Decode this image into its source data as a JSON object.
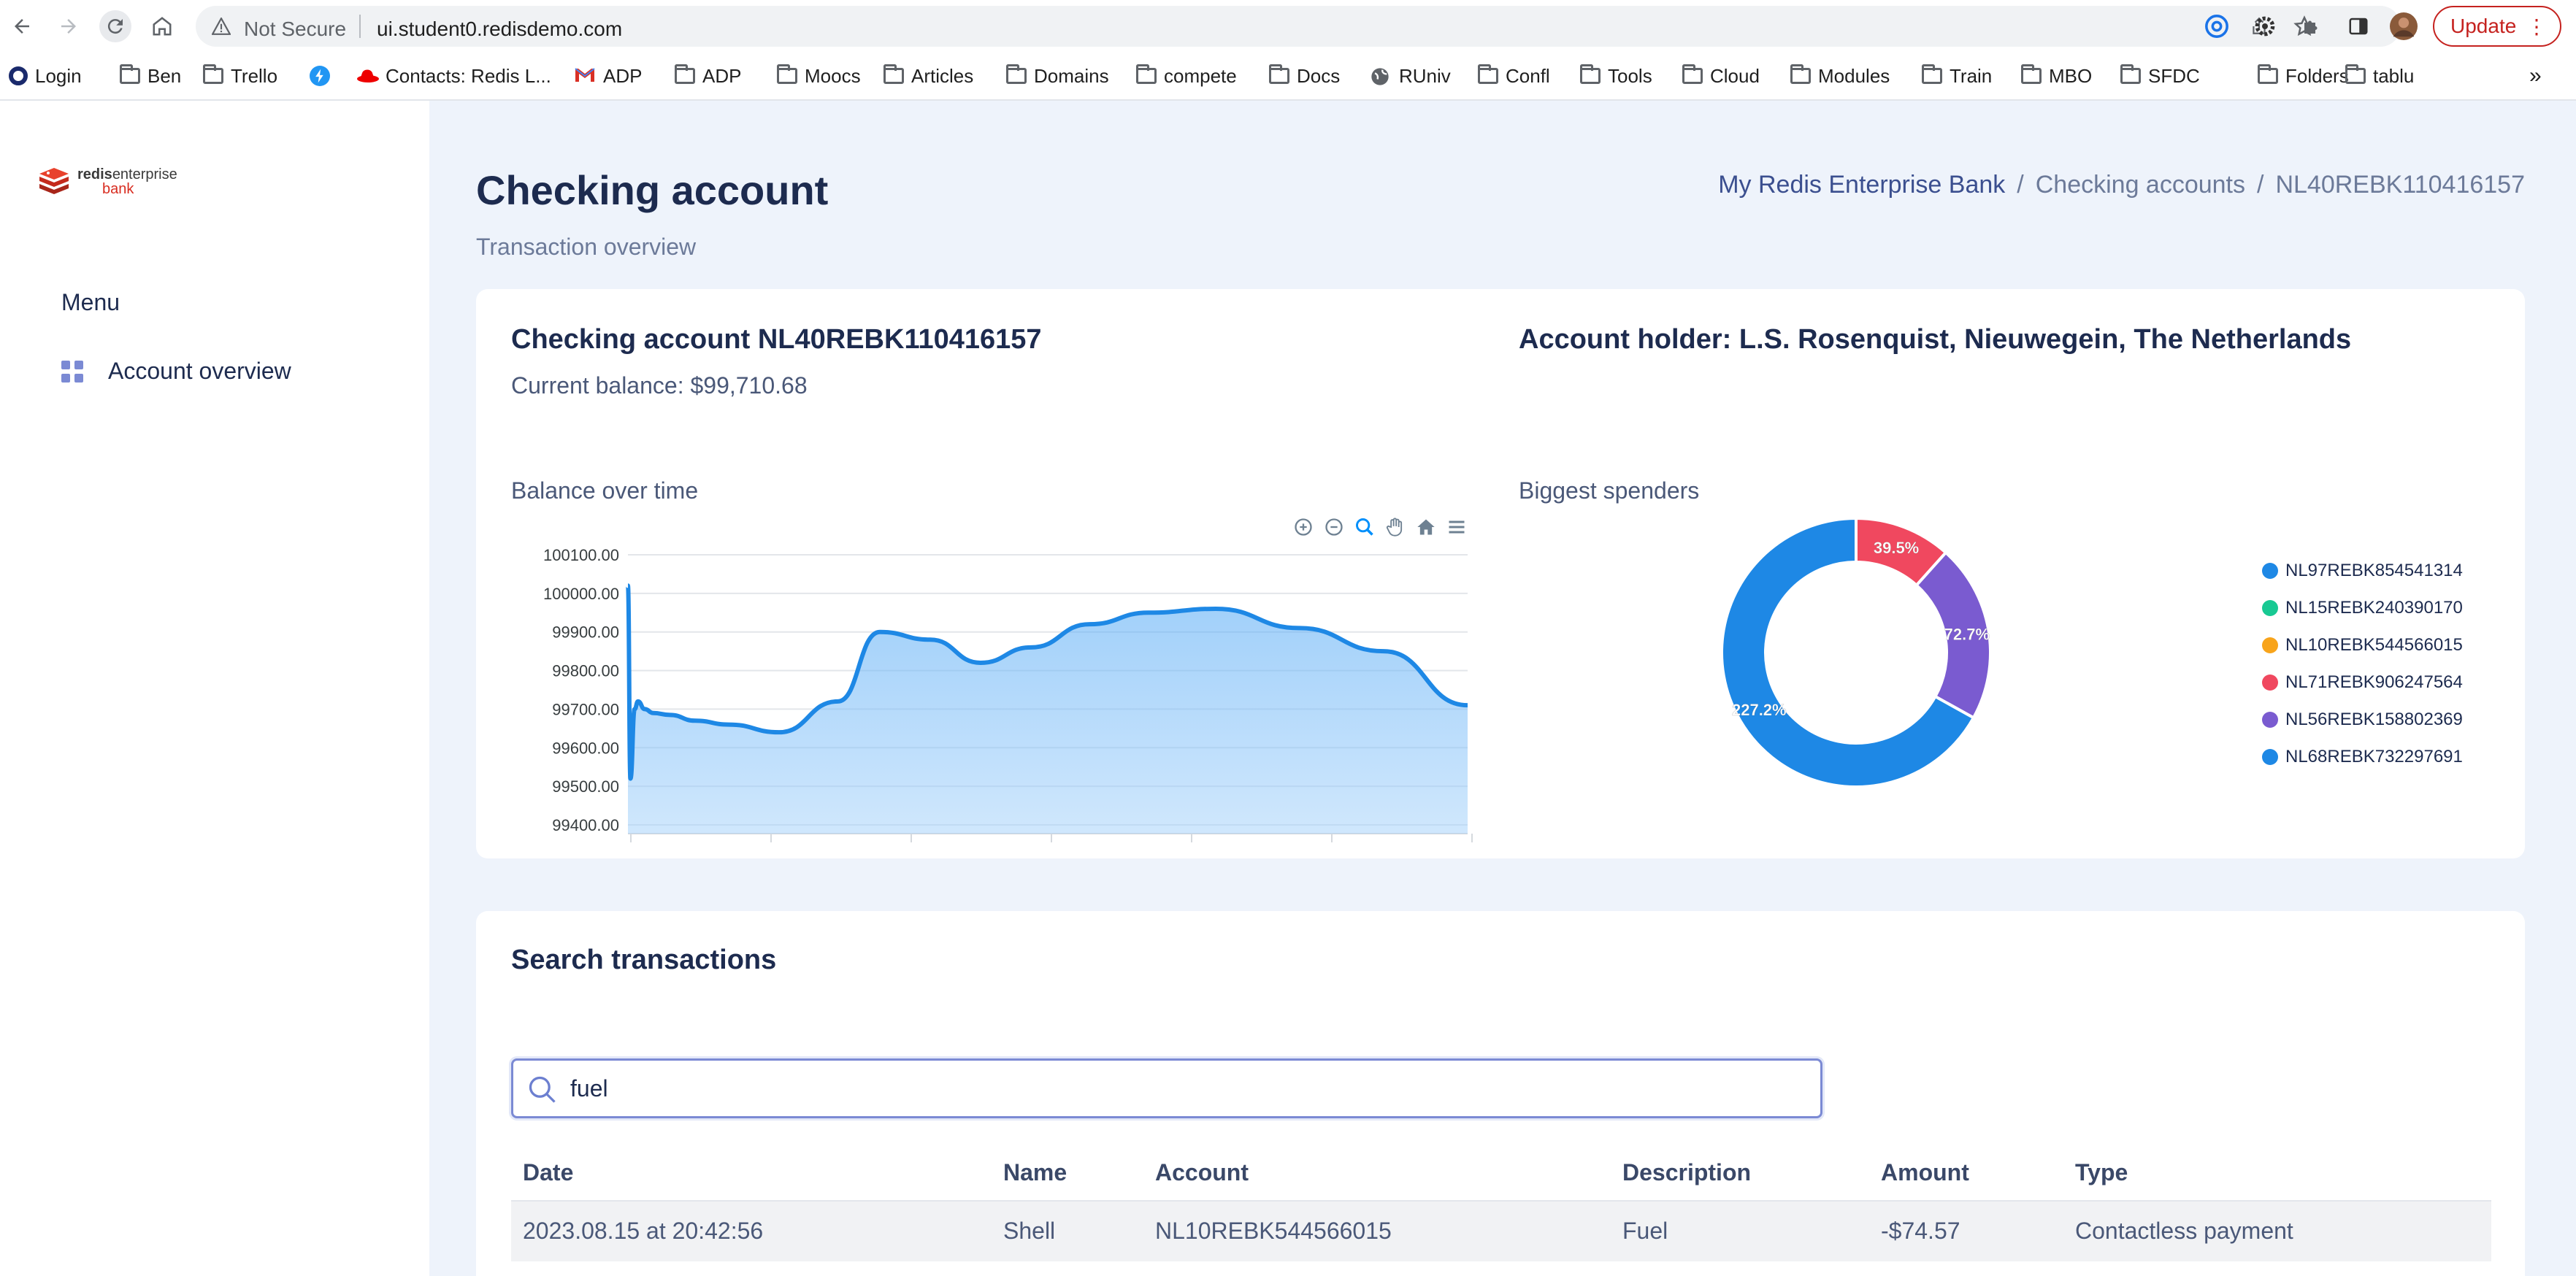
{
  "browser": {
    "security_label": "Not Secure",
    "url": "ui.student0.redisdemo.com",
    "update_label": "Update",
    "bookmarks": [
      {
        "label": "Login",
        "icon": "circle-logo-icon"
      },
      {
        "label": "Ben",
        "icon": "folder-icon"
      },
      {
        "label": "Trello",
        "icon": "folder-icon"
      },
      {
        "label": "",
        "icon": "bolt-app-icon"
      },
      {
        "label": "Contacts: Redis L...",
        "icon": "redhat-icon"
      },
      {
        "label": "ADP",
        "icon": "gmail-icon"
      },
      {
        "label": "ADP",
        "icon": "folder-icon"
      },
      {
        "label": "Moocs",
        "icon": "folder-icon"
      },
      {
        "label": "Articles",
        "icon": "folder-icon"
      },
      {
        "label": "Domains",
        "icon": "folder-icon"
      },
      {
        "label": "compete",
        "icon": "folder-icon"
      },
      {
        "label": "Docs",
        "icon": "folder-icon"
      },
      {
        "label": "RUniv",
        "icon": "globe-icon"
      },
      {
        "label": "Confl",
        "icon": "folder-icon"
      },
      {
        "label": "Tools",
        "icon": "folder-icon"
      },
      {
        "label": "Cloud",
        "icon": "folder-icon"
      },
      {
        "label": "Modules",
        "icon": "folder-icon"
      },
      {
        "label": "Train",
        "icon": "folder-icon"
      },
      {
        "label": "MBO",
        "icon": "folder-icon"
      },
      {
        "label": "SFDC",
        "icon": "folder-icon"
      },
      {
        "label": "Folders",
        "icon": "folder-icon"
      },
      {
        "label": "tablu",
        "icon": "folder-icon"
      }
    ],
    "more_label": "»"
  },
  "sidebar": {
    "logo_text_bold": "redis",
    "logo_text_light": "enterprise",
    "logo_text_sub": "bank",
    "menu_title": "Menu",
    "items": [
      {
        "label": "Account overview",
        "icon": "grid-icon"
      }
    ]
  },
  "header": {
    "title": "Checking account",
    "subtitle": "Transaction overview",
    "breadcrumb": [
      "My Redis Enterprise Bank",
      "Checking accounts",
      "NL40REBK110416157"
    ]
  },
  "account": {
    "title": "Checking account NL40REBK110416157",
    "balance": "Current balance: $99,710.68",
    "holder": "Account holder: L.S. Rosenquist, Nieuwegein, The Netherlands"
  },
  "charts": {
    "balance_label": "Balance over time",
    "spenders_label": "Biggest spenders"
  },
  "chart_data": [
    {
      "type": "area",
      "title": "Balance over time",
      "y_ticks": [
        "100100.00",
        "100000.00",
        "99900.00",
        "99800.00",
        "99700.00",
        "99600.00",
        "99500.00",
        "99400.00"
      ],
      "ylim": [
        99400,
        100100
      ],
      "x": [
        0,
        0.3,
        0.8,
        1.2,
        2,
        3,
        5,
        8,
        12,
        18,
        25,
        30,
        36,
        42,
        48,
        55,
        62,
        70,
        80,
        90,
        100
      ],
      "values": [
        100020,
        99520,
        99700,
        99720,
        99700,
        99690,
        99685,
        99670,
        99660,
        99640,
        99720,
        99900,
        99880,
        99820,
        99860,
        99920,
        99950,
        99960,
        99910,
        99850,
        99710
      ],
      "grid": true
    },
    {
      "type": "pie",
      "title": "Biggest spenders",
      "labels": [
        "NL97REBK854541314",
        "NL15REBK240390170",
        "NL10REBK544566015",
        "NL71REBK906247564",
        "NL56REBK158802369",
        "NL68REBK732297691"
      ],
      "values": [
        0,
        0,
        0,
        39.5,
        72.7,
        227.2
      ],
      "data_labels": [
        "",
        "",
        "",
        "39.5%",
        "72.7%",
        "227.2%"
      ],
      "colors": [
        "#1e88e5",
        "#18c993",
        "#f8a41b",
        "#f0485f",
        "#7a5bd0",
        "#1e88e5"
      ],
      "legend": "right"
    }
  ],
  "search": {
    "title": "Search transactions",
    "query": "fuel",
    "columns": [
      "Date",
      "Name",
      "Account",
      "Description",
      "Amount",
      "Type"
    ],
    "rows": [
      [
        "2023.08.15 at 20:42:56",
        "Shell",
        "NL10REBK544566015",
        "Fuel",
        "-$74.57",
        "Contactless payment"
      ]
    ]
  }
}
